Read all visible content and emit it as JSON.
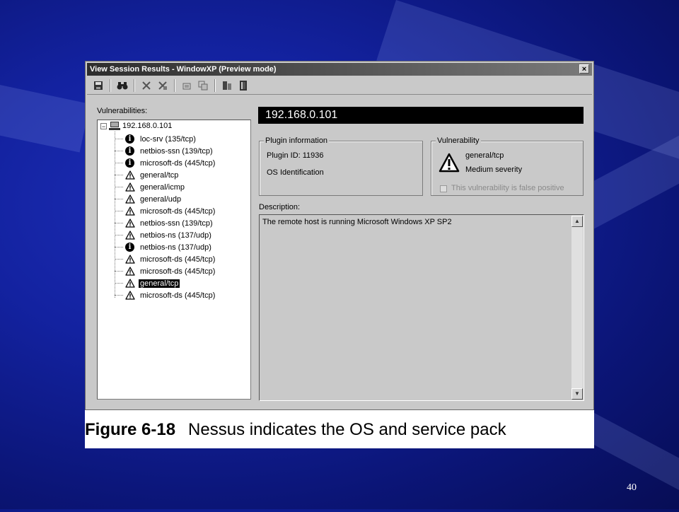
{
  "window": {
    "title": "View Session Results - WindowXP (Preview mode)",
    "close_label": "×"
  },
  "toolbar": {
    "buttons": [
      {
        "icon": "save-icon",
        "glyph": "🖫"
      },
      {
        "icon": "binoculars-icon",
        "glyph": "👓"
      },
      {
        "icon": "delete-icon",
        "glyph": "✕"
      },
      {
        "icon": "delete-all-icon",
        "glyph": "✗"
      },
      {
        "icon": "export-icon",
        "glyph": "▤"
      },
      {
        "icon": "export-all-icon",
        "glyph": "▥"
      },
      {
        "icon": "report-icon",
        "glyph": "▦"
      },
      {
        "icon": "exit-icon",
        "glyph": "▯"
      }
    ]
  },
  "vulnerabilities": {
    "label": "Vulnerabilities:",
    "root": {
      "expander": "−",
      "label": "192.168.0.101"
    },
    "items": [
      {
        "type": "info",
        "label": "loc-srv (135/tcp)",
        "selected": false
      },
      {
        "type": "info",
        "label": "netbios-ssn (139/tcp)",
        "selected": false
      },
      {
        "type": "info",
        "label": "microsoft-ds (445/tcp)",
        "selected": false
      },
      {
        "type": "warn",
        "label": "general/tcp",
        "selected": false
      },
      {
        "type": "warn",
        "label": "general/icmp",
        "selected": false
      },
      {
        "type": "warn",
        "label": "general/udp",
        "selected": false
      },
      {
        "type": "warn",
        "label": "microsoft-ds (445/tcp)",
        "selected": false
      },
      {
        "type": "warn",
        "label": "netbios-ssn (139/tcp)",
        "selected": false
      },
      {
        "type": "warn",
        "label": "netbios-ns (137/udp)",
        "selected": false
      },
      {
        "type": "info",
        "label": "netbios-ns (137/udp)",
        "selected": false
      },
      {
        "type": "warn",
        "label": "microsoft-ds (445/tcp)",
        "selected": false
      },
      {
        "type": "warn",
        "label": "microsoft-ds (445/tcp)",
        "selected": false
      },
      {
        "type": "warn",
        "label": "general/tcp",
        "selected": true
      },
      {
        "type": "warn",
        "label": "microsoft-ds (445/tcp)",
        "selected": false
      }
    ]
  },
  "detail": {
    "host": "192.168.0.101",
    "plugin_info": {
      "title": "Plugin information",
      "plugin_id": "Plugin ID: 11936",
      "name": "OS Identification"
    },
    "vulnerability": {
      "title": "Vulnerability",
      "port": "general/tcp",
      "severity": "Medium severity",
      "false_positive_label": "This vulnerability is false positive"
    },
    "description": {
      "label": "Description:",
      "text": "The remote host is running Microsoft Windows XP SP2"
    },
    "scroll_up": "▲",
    "scroll_down": "▼"
  },
  "caption": {
    "figure_number": "Figure 6-18",
    "text": "Nessus indicates the OS and service pack"
  },
  "slide": {
    "page_number": "40"
  },
  "colors": {
    "background": "#1322a0",
    "window": "#c9c9c9",
    "host_bar": "#000000"
  }
}
